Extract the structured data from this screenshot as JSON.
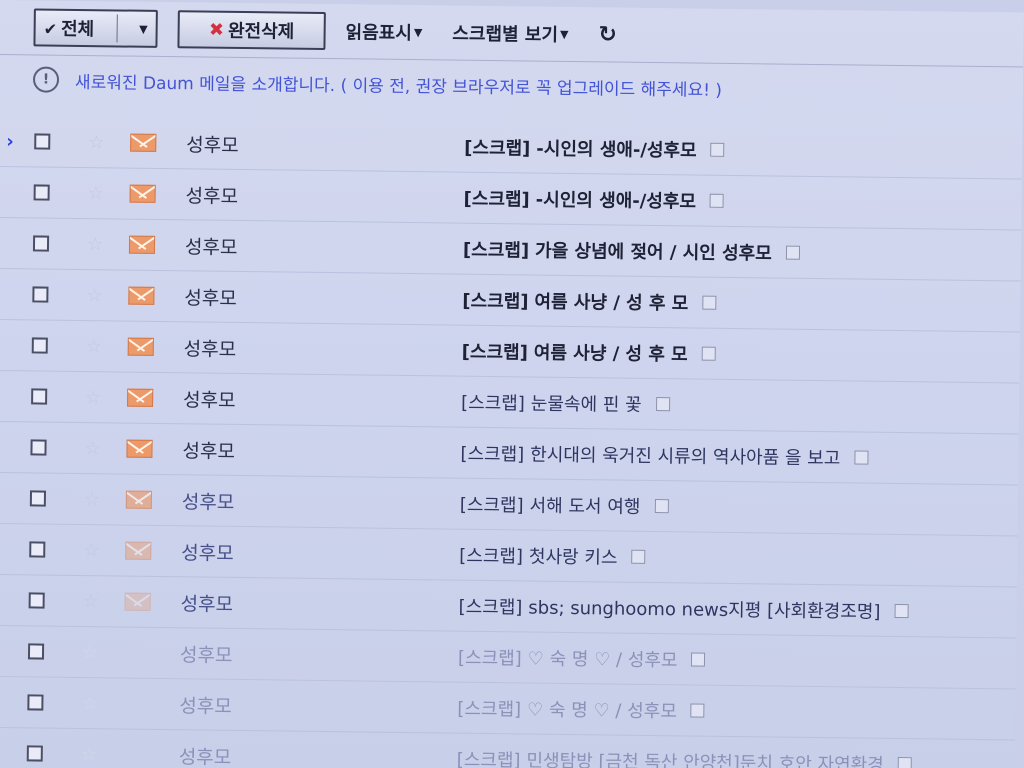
{
  "toolbar": {
    "all_label": "전체",
    "delete_label": "완전삭제",
    "mark_read_label": "읽음표시",
    "scrap_view_label": "스크랩별 보기"
  },
  "notice": {
    "text": "새로워진 Daum 메일을 소개합니다. ( 이용 전, 권장 브라우저로 꼭 업그레이드 해주세요! )"
  },
  "colors": {
    "notice_text": "#4353d6",
    "envelope": "#ec9a6a",
    "delete_x": "#d63040",
    "selected_cursor": "#2d3de0"
  },
  "mails": [
    {
      "sender": "성후모",
      "tag": "[스크랩]",
      "subject": "-시인의 생애-/성후모"
    },
    {
      "sender": "성후모",
      "tag": "[스크랩]",
      "subject": "-시인의 생애-/성후모"
    },
    {
      "sender": "성후모",
      "tag": "[스크랩]",
      "subject": "가을 상념에 젖어 / 시인 성후모"
    },
    {
      "sender": "성후모",
      "tag": "[스크랩]",
      "subject": "여름 사냥 / 성 후 모"
    },
    {
      "sender": "성후모",
      "tag": "[스크랩]",
      "subject": "여름 사냥 / 성 후 모"
    },
    {
      "sender": "성후모",
      "tag": "[스크랩]",
      "subject": "눈물속에 핀 꽃"
    },
    {
      "sender": "성후모",
      "tag": "[스크랩]",
      "subject": "한시대의 욱거진 시류의 역사아품 을 보고"
    },
    {
      "sender": "성후모",
      "tag": "[스크랩]",
      "subject": "서해 도서 여행"
    },
    {
      "sender": "성후모",
      "tag": "[스크랩]",
      "subject": "첫사랑 키스"
    },
    {
      "sender": "성후모",
      "tag": "[스크랩]",
      "subject": "sbs; sunghoomo news지평 [사회환경조명]"
    },
    {
      "sender": "성후모",
      "tag": "[스크랩]",
      "subject": "♡ 숙 명 ♡ / 성후모"
    },
    {
      "sender": "성후모",
      "tag": "[스크랩]",
      "subject": "♡ 숙 명 ♡ / 성후모"
    },
    {
      "sender": "성후모",
      "tag": "[스크랩]",
      "subject": "민생탐방 [금천 독산 안양천]둔치 호안 자연환경"
    }
  ]
}
